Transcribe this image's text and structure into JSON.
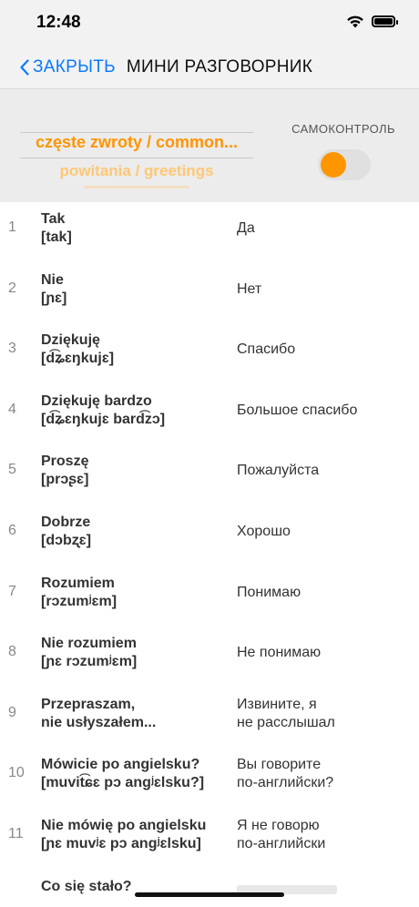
{
  "status": {
    "time": "12:48",
    "icons": [
      "wifi-icon",
      "battery-icon"
    ]
  },
  "nav": {
    "back_label": "ЗАКРЫТЬ",
    "title": "МИНИ РАЗГОВОРНИК"
  },
  "controls": {
    "picker_selected": "częste zwroty / common...",
    "picker_next": "powitania / greetings",
    "self_check_label": "САМОКОНТРОЛЬ",
    "self_check_on": true
  },
  "colors": {
    "accent": "#ff9500",
    "link": "#0a7aff"
  },
  "phrases": [
    {
      "num": "1",
      "pl": "Tak",
      "ipa": "[tak]",
      "ru": "Да"
    },
    {
      "num": "2",
      "pl": "Nie",
      "ipa": "[ɲɛ]",
      "ru": "Нет"
    },
    {
      "num": "3",
      "pl": "Dziękuję",
      "ipa": "[d͡ʑɛŋkujɛ]",
      "ru": "Спасибо"
    },
    {
      "num": "4",
      "pl": "Dziękuję bardzo",
      "ipa": "[d͡ʑɛŋkujɛ bard͡zɔ]",
      "ru": "Большое спасибо"
    },
    {
      "num": "5",
      "pl": "Proszę",
      "ipa": "[prɔʂɛ]",
      "ru": "Пожалуйста"
    },
    {
      "num": "6",
      "pl": "Dobrze",
      "ipa": "[dɔbʐɛ]",
      "ru": "Хорошо"
    },
    {
      "num": "7",
      "pl": "Rozumiem",
      "ipa": "[rɔzumʲɛm]",
      "ru": "Понимаю"
    },
    {
      "num": "8",
      "pl": "Nie rozumiem",
      "ipa": "[ɲɛ rɔzumʲɛm]",
      "ru": "Не понимаю"
    },
    {
      "num": "9",
      "pl": "Przepraszam,",
      "ipa": "nie usłyszałem...",
      "ru": "Извините, я",
      "ru2": "не расслышал"
    },
    {
      "num": "10",
      "pl": "Mówicie po angielsku?",
      "ipa": "[muvit͡ɕɛ pɔ angʲɛlsku?]",
      "ru": "Вы говорите",
      "ru2": "по-английски?"
    },
    {
      "num": "11",
      "pl": "Nie mówię po angielsku",
      "ipa": "[ɲɛ muvʲɛ pɔ angʲɛlsku]",
      "ru": "Я не говорю",
      "ru2": "по-английски"
    }
  ],
  "cut_row": {
    "pl": "Co się stało?"
  }
}
